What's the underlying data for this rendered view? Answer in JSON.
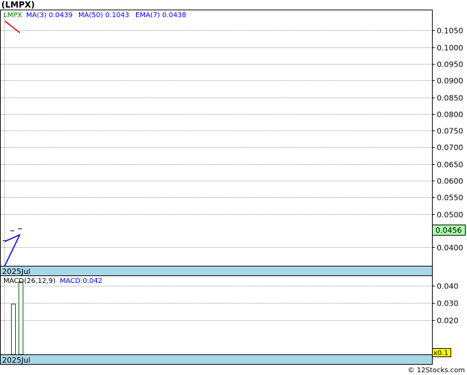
{
  "header": {
    "title": "(LMPX)"
  },
  "price_legend": {
    "symbol": "LMPX",
    "ma3": "MA(3)  0.0439",
    "ma50": "MA(50)  0.1043",
    "ema7": "EMA(7)  0.0438"
  },
  "macd_legend": {
    "label": "MACD(26,12,9)",
    "value": "MACD:0.042"
  },
  "colors": {
    "symbol": "#008000",
    "ma3": "#0000ff",
    "ma50": "#ee0000",
    "ema7": "#0000ff",
    "price_bar": "#000000",
    "macd_bar": "#006400",
    "grid": "#999999",
    "band": "#a8d8e8",
    "last_price_box": "#aaffaa",
    "multiplier_box": "#ffff00"
  },
  "chart_data": [
    {
      "type": "line",
      "name_in_chart": "price",
      "ylim": [
        0.0345,
        0.11
      ],
      "y_ticks": [
        "0.1050",
        "0.1000",
        "0.0950",
        "0.0900",
        "0.0850",
        "0.0800",
        "0.0750",
        "0.0700",
        "0.0650",
        "0.0600",
        "0.0550",
        "0.0500",
        "0.0400"
      ],
      "x_label": "2025Jul",
      "last_price": "0.0456",
      "bars": [
        {
          "x": 0,
          "high": 0.042,
          "low": 0.042,
          "close": 0.042
        },
        {
          "x": 1,
          "high": 0.045,
          "low": 0.045,
          "close": 0.045
        },
        {
          "x": 2,
          "high": 0.0456,
          "low": 0.0456,
          "close": 0.0456
        }
      ],
      "series": [
        {
          "name": "MA(3)",
          "x": [
            0,
            2
          ],
          "values": [
            0.0345,
            0.0439
          ]
        },
        {
          "name": "MA(50)",
          "x": [
            0,
            2
          ],
          "values": [
            0.1078,
            0.1043
          ]
        },
        {
          "name": "EMA(7)",
          "x": [
            0,
            1,
            2
          ],
          "values": [
            0.0418,
            0.0428,
            0.0438
          ]
        }
      ]
    },
    {
      "type": "bar",
      "name_in_chart": "macd",
      "ylim": [
        0.0,
        0.045
      ],
      "y_ticks": [
        "0.040",
        "0.030",
        "0.020"
      ],
      "x_label": "2025Jul",
      "multiplier": "x0.1",
      "bars": [
        {
          "x": 1,
          "value": 0.0294
        },
        {
          "x": 2,
          "value": 0.0424
        }
      ]
    }
  ],
  "footer": {
    "credit": "© 12Stocks.com"
  }
}
